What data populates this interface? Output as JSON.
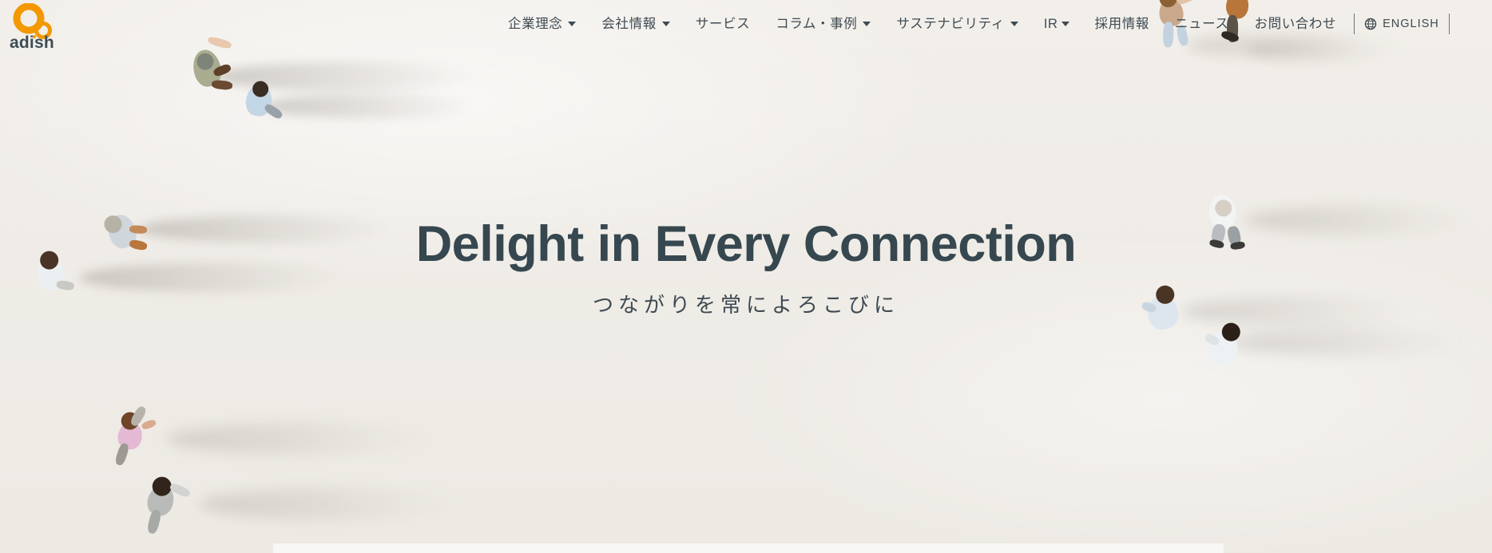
{
  "brand": {
    "logo_name": "adish-logo",
    "logo_text": "adish",
    "accent_color": "#f39800",
    "text_color": "#3d4d55"
  },
  "nav": {
    "items": [
      {
        "label": "企業理念",
        "has_dropdown": true
      },
      {
        "label": "会社情報",
        "has_dropdown": true
      },
      {
        "label": "サービス",
        "has_dropdown": false
      },
      {
        "label": "コラム・事例",
        "has_dropdown": true
      },
      {
        "label": "サステナビリティ",
        "has_dropdown": true
      },
      {
        "label": "IR",
        "has_dropdown": true
      },
      {
        "label": "採用情報",
        "has_dropdown": false
      },
      {
        "label": "ニュース",
        "has_dropdown": false
      },
      {
        "label": "お問い合わせ",
        "has_dropdown": false
      }
    ],
    "language": {
      "label": "ENGLISH",
      "icon": "globe-icon"
    }
  },
  "hero": {
    "title": "Delight in Every Connection",
    "subtitle": "つながりを常によろこびに",
    "background_color": "#f0ede8",
    "title_color": "#36474f"
  }
}
